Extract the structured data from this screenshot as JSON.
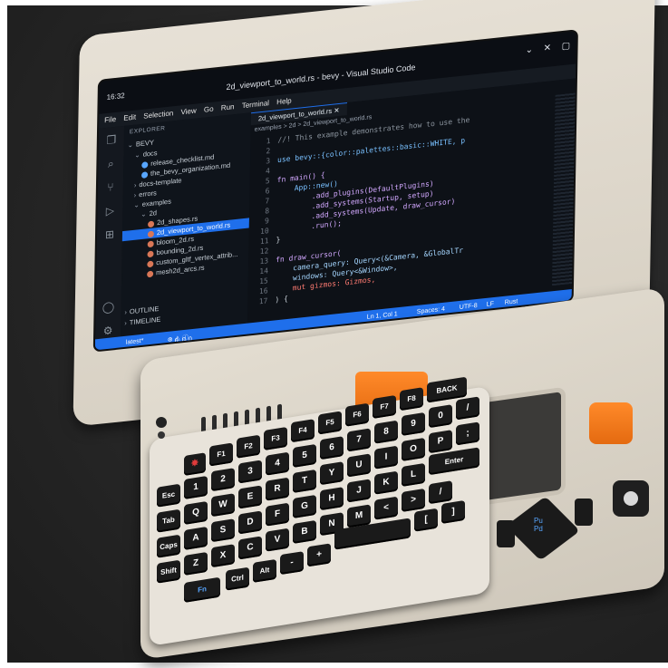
{
  "vscode": {
    "time": "16:32",
    "window_title": "2d_viewport_to_world.rs - bevy - Visual Studio Code",
    "menu": [
      "File",
      "Edit",
      "Selection",
      "View",
      "Go",
      "Run",
      "Terminal",
      "Help"
    ],
    "explorer_title": "EXPLORER",
    "workspace": "BEVY",
    "tree": [
      {
        "label": "docs",
        "kind": "folder"
      },
      {
        "label": "release_checklist.md",
        "kind": "file"
      },
      {
        "label": "the_bevy_organization.md",
        "kind": "file"
      },
      {
        "label": "docs-template",
        "kind": "folder"
      },
      {
        "label": "errors",
        "kind": "folder"
      },
      {
        "label": "examples",
        "kind": "folder"
      },
      {
        "label": "2d",
        "kind": "folder"
      },
      {
        "label": "2d_shapes.rs",
        "kind": "file"
      },
      {
        "label": "2d_viewport_to_world.rs",
        "kind": "file",
        "selected": true
      },
      {
        "label": "bloom_2d.rs",
        "kind": "file"
      },
      {
        "label": "bounding_2d.rs",
        "kind": "file"
      },
      {
        "label": "custom_gltf_vertex_attrib...",
        "kind": "file"
      },
      {
        "label": "mesh2d_arcs.rs",
        "kind": "file"
      },
      {
        "label": "OUTLINE",
        "kind": "section"
      },
      {
        "label": "TIMELINE",
        "kind": "section"
      }
    ],
    "tab_label": "2d_viewport_to_world.rs",
    "breadcrumb": "examples > 2d > 2d_viewport_to_world.rs",
    "code": [
      {
        "n": "1",
        "text": "//! This example demonstrates how to use the"
      },
      {
        "n": "2",
        "text": ""
      },
      {
        "n": "3",
        "text": "use bevy::{color::palettes::basic::WHITE, p"
      },
      {
        "n": "4",
        "text": ""
      },
      {
        "n": "5",
        "text": "fn main() {"
      },
      {
        "n": "6",
        "text": "    App::new()"
      },
      {
        "n": "7",
        "text": "        .add_plugins(DefaultPlugins)"
      },
      {
        "n": "8",
        "text": "        .add_systems(Startup, setup)"
      },
      {
        "n": "9",
        "text": "        .add_systems(Update, draw_cursor)"
      },
      {
        "n": "10",
        "text": "        .run();"
      },
      {
        "n": "11",
        "text": "}"
      },
      {
        "n": "12",
        "text": ""
      },
      {
        "n": "13",
        "text": "fn draw_cursor("
      },
      {
        "n": "14",
        "text": "    camera_query: Query<(&Camera, &GlobalTr"
      },
      {
        "n": "15",
        "text": "    windows: Query<&Window>,"
      },
      {
        "n": "16",
        "text": "    mut gizmos: Gizmos,"
      },
      {
        "n": "17",
        "text": ") {"
      }
    ],
    "status_left": "latest*",
    "status_errors": "0",
    "status_warnings": "0",
    "status_info": "0",
    "status_right": [
      "Ln 1, Col 1",
      "Spaces: 4",
      "UTF-8",
      "LF",
      "Rust"
    ]
  },
  "keyboard": {
    "row0": [
      "F1",
      "F2",
      "F3",
      "F4",
      "F5",
      "F6",
      "F7",
      "F8",
      "BACK"
    ],
    "row0_sub": [
      "RF",
      "PrtSc",
      "",
      "",
      "",
      "",
      "",
      "",
      "Del"
    ],
    "row1": [
      "Esc",
      "1",
      "2",
      "3",
      "4",
      "5",
      "6",
      "7",
      "8",
      "9",
      "0",
      "/"
    ],
    "row2": [
      "Tab",
      "Q",
      "W",
      "E",
      "R",
      "T",
      "Y",
      "U",
      "I",
      "O",
      "P",
      ";"
    ],
    "row3": [
      "Caps",
      "A",
      "S",
      "D",
      "F",
      "G",
      "H",
      "J",
      "K",
      "L",
      "Enter"
    ],
    "row4": [
      "Shift",
      "Z",
      "X",
      "C",
      "V",
      "B",
      "N",
      "M",
      "<",
      ">",
      "/"
    ],
    "row5": [
      "Fn",
      "Ctrl",
      "Alt",
      "-",
      "+",
      "[",
      "]"
    ],
    "nav_pu": "Pu",
    "nav_pd": "Pd",
    "enter_sub": "CTRL+ALT+DEL"
  }
}
